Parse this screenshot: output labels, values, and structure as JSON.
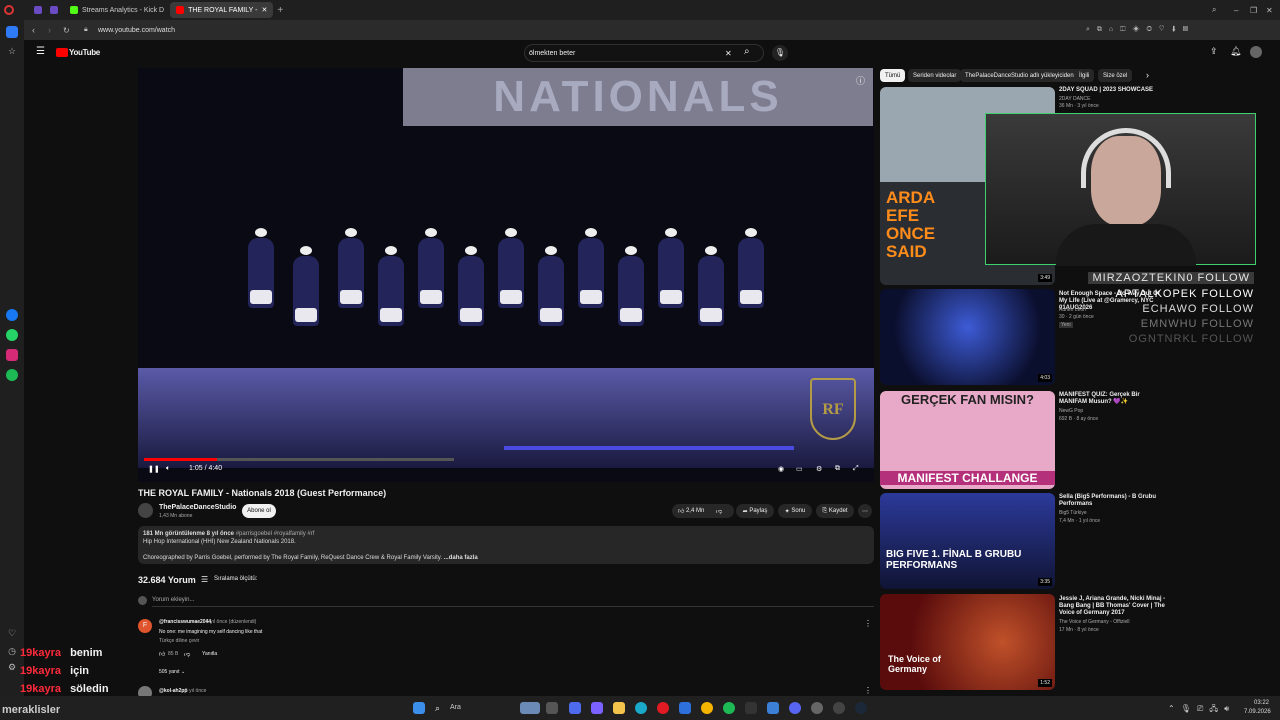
{
  "browser": {
    "tabs": [
      {
        "label": "Streams Analytics - Kick D"
      },
      {
        "label": "THE ROYAL FAMILY -"
      }
    ],
    "url": "www.youtube.com/watch"
  },
  "youtube": {
    "logo": "YouTube",
    "search_value": "ölmekten beter"
  },
  "video": {
    "banner_text": "NATIONALS",
    "time": "1:05 / 4:40",
    "progress": 0.235,
    "title": "THE ROYAL FAMILY - Nationals 2018 (Guest Performance)",
    "watermark": "RF"
  },
  "channel": {
    "name": "ThePalaceDanceStudio",
    "subs": "1,43 Mn abone",
    "subscribe_label": "Abone ol"
  },
  "actions": {
    "likes": "2,4 Mn",
    "share": "Paylaş",
    "remix": "Sonu",
    "save": "Kaydet"
  },
  "description": {
    "meta": "181 Mn görüntülenme  8 yıl önce",
    "tags": "#parrisgoebel #royalfamily #rf",
    "line1": "Hip Hop International (HHI) New Zealand Nationals 2018.",
    "line2": "Choreographed by Parris Goebel, performed by The Royal Family, ReQuest Dance Crew & Royal Family Varsity.",
    "more": "...daha fazla"
  },
  "comments": {
    "count": "32.684 Yorum",
    "sort": "Sıralama ölçütü:",
    "add_placeholder": "Yorum ekleyin...",
    "items": [
      {
        "user": "@francisswumae2044",
        "time": "5 yıl önce (düzenlendi)",
        "text": "No one: me imagining my self dancing like that",
        "translate": "Türkçe diline çevir",
        "likes": "85 B",
        "reply": "Yanıtla",
        "replies": "505 yanıt"
      },
      {
        "user": "@kol-ah2pp",
        "time": "5 yıl önce"
      }
    ]
  },
  "filters": [
    "Tümü",
    "Seriden videolar",
    "ThePalaceDanceStudio adlı yükleyiciden",
    "İlgili",
    "Size özel"
  ],
  "related": [
    {
      "title": "2DAY SQUAD | 2023 SHOWCASE",
      "channel": "2DAY DANCE",
      "meta": "36 Mn · 3 yıl önce",
      "duration": "3:49",
      "thumb_text": "ARDA EFE ONCE SAID"
    },
    {
      "title": "Not Enough Space - No Way Out Of My Life (Live at @Gramercy, NYC 01AUG2026",
      "channel": "Adrien Leon",
      "meta": "30 · 2 gün önce",
      "badge": "Yeni",
      "duration": "4:03"
    },
    {
      "title": "MANIFEST QUIZ: Gerçek Bir MANIFAM Musun? 💜✨",
      "channel": "NewG Pop",
      "meta": "692 B · 8 ay önce",
      "thumb_text": "GERÇEK FAN MISIN?",
      "thumb_text2": "MANIFEST CHALLANGE"
    },
    {
      "title": "Sella (Big5 Performans) - B Grubu Performans",
      "channel": "Big5 Türkiye",
      "meta": "7,4 Mn · 1 yıl önce",
      "duration": "3:35",
      "thumb_text": "BIG FIVE 1. FİNAL B GRUBU PERFORMANS"
    },
    {
      "title": "Jessie J, Ariana Grande, Nicki Minaj - Bang Bang | BB Thomas' Cover | The Voice of Germany 2017",
      "channel": "The Voice of Germany - Offiziell",
      "meta": "17 Mn · 8 yıl önce",
      "duration": "1:52",
      "thumb_text": "The Voice of Germany"
    }
  ],
  "overlay": {
    "follows": [
      "MIRZAOZTEKIN0 FOLLOW",
      "APTALKOPEK FOLLOW",
      "ECHAWO FOLLOW",
      "EMNWHU FOLLOW",
      "OGNTNRKL FOLLOW"
    ],
    "chat": [
      {
        "user": "19kayra",
        "msg": "benim"
      },
      {
        "user": "19kayra",
        "msg": "için"
      },
      {
        "user": "19kayra",
        "msg": "söledin"
      }
    ],
    "footer_name": "meraklisler"
  },
  "taskbar": {
    "search": "Ara",
    "time": "03:22",
    "date": "7.09.2026"
  },
  "colors": {
    "accent": "#ff0000",
    "chat_user": "#ff2a3a",
    "cam_border": "#3fd070"
  }
}
